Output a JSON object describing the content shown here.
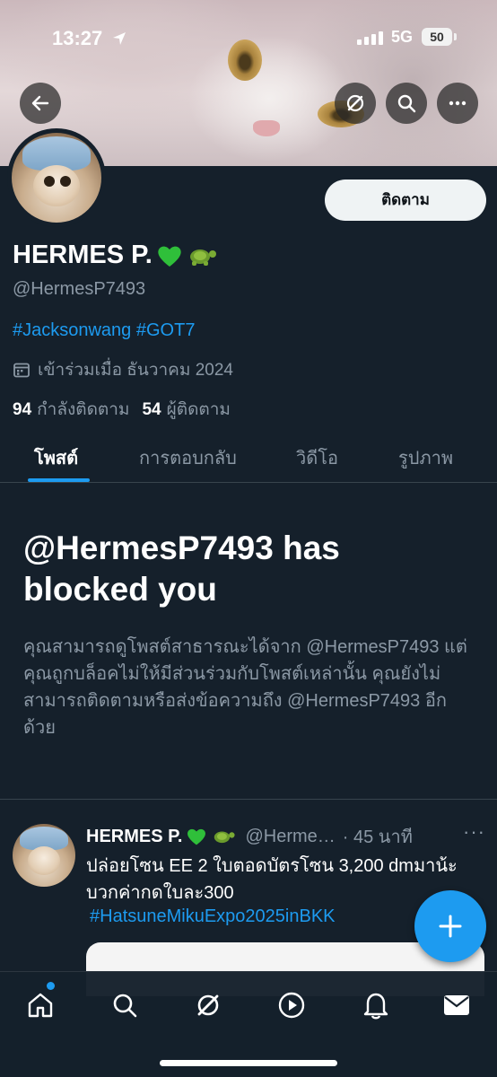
{
  "status_bar": {
    "time": "13:27",
    "network": "5G",
    "battery": "50"
  },
  "profile": {
    "follow_label": "ติดตาม",
    "display_name": "HERMES P.",
    "handle": "@HermesP7493",
    "bio": "#Jacksonwang #GOT7",
    "joined": "เข้าร่วมเมื่อ ธันวาคม 2024",
    "following_count": "94",
    "following_label": "กำลังติดตาม",
    "followers_count": "54",
    "followers_label": "ผู้ติดตาม"
  },
  "tabs": [
    {
      "label": "โพสต์",
      "active": true
    },
    {
      "label": "การตอบกลับ",
      "active": false
    },
    {
      "label": "วิดีโอ",
      "active": false
    },
    {
      "label": "รูปภาพ",
      "active": false
    }
  ],
  "blocked": {
    "title": "@HermesP7493 has blocked you",
    "description": "คุณสามารถดูโพสต์สาธารณะได้จาก @HermesP7493 แต่คุณถูกบล็อคไม่ให้มีส่วนร่วมกับโพสต์เหล่านั้น คุณยังไม่สามารถติดตามหรือส่งข้อความถึง @HermesP7493 อีกด้วย"
  },
  "tweet": {
    "name": "HERMES P.",
    "handle": "@Herme…",
    "time": "· 45 นาที",
    "more": "···",
    "text": "ปล่อยโซน EE 2 ใบตอดบัตรโซน 3,200 dmมาน้ะบวกค่ากดใบละ300",
    "hashtag": "#HatsuneMikuExpo2025inBKK"
  },
  "icons": {
    "back": "back-arrow-icon",
    "grok": "grok-icon",
    "search": "search-icon",
    "more": "more-icon",
    "compose": "plus-icon"
  },
  "colors": {
    "accent": "#1d9bf0",
    "background": "#15202b",
    "secondary_text": "#8b98a5",
    "heart": "#2fbf3a"
  }
}
